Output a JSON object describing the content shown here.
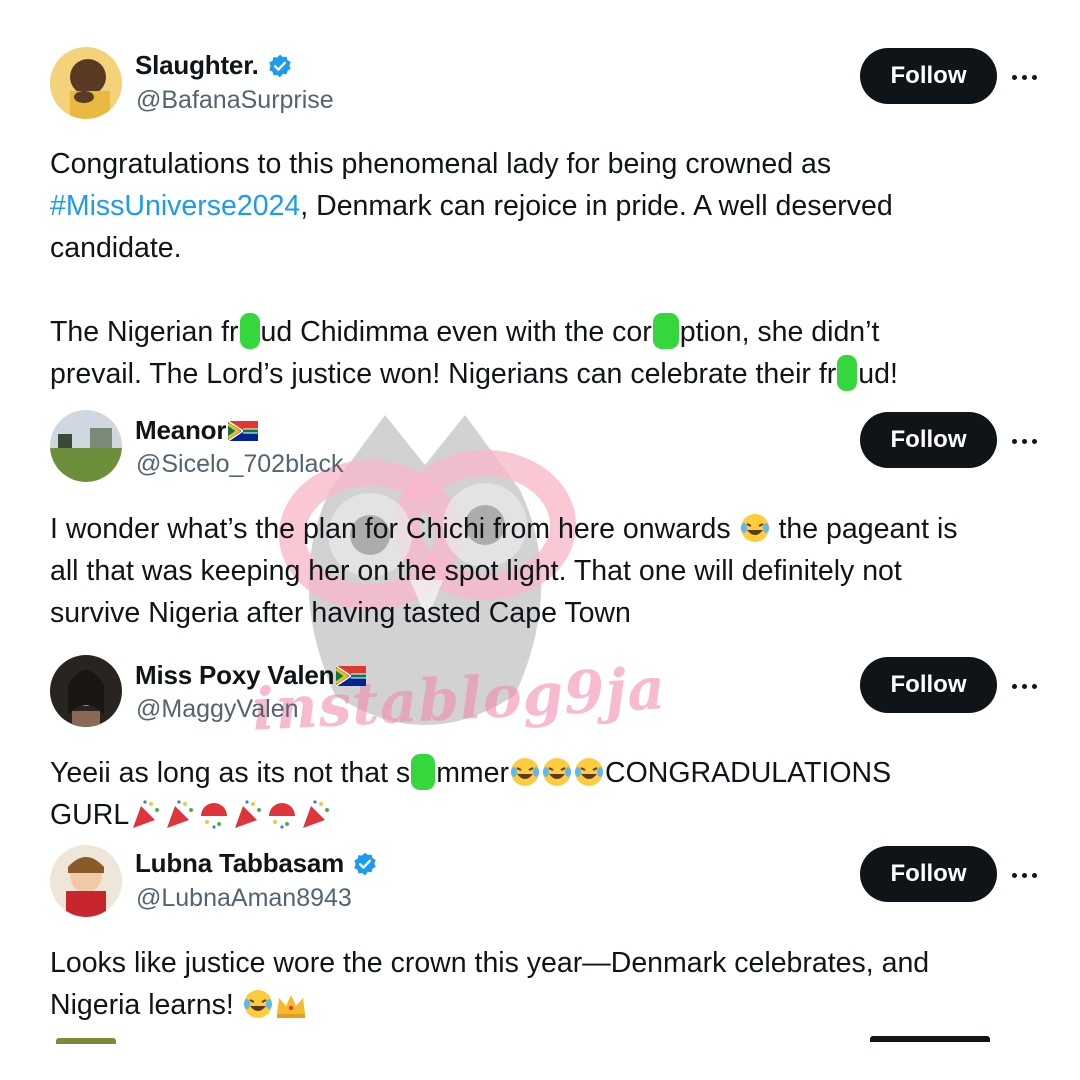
{
  "follow_label": "Follow",
  "tweets": [
    {
      "name": "Slaughter.",
      "handle": "@BafanaSurprise",
      "verified": true,
      "line1": "Congratulations to this phenomenal lady for being crowned as",
      "hashtag": "#MissUniverse2024",
      "line2_rest": ", Denmark can rejoice in pride. A well deserved",
      "line3": "candidate.",
      "line4_a": "The Nigerian fr",
      "line4_b": "ud Chidimma even with the cor",
      "line4_c": "ption, she didn’t",
      "line5_a": "prevail. The Lord’s justice won! Nigerians can celebrate their fr",
      "line5_b": "ud!"
    },
    {
      "name": "Meanor",
      "handle": "@Sicelo_702black",
      "flag": "south-africa-flag",
      "line1_a": "I wonder what’s the plan for Chichi from here onwards",
      "line1_b": "the pageant is",
      "line2": "all that was keeping her on the spot light. That one will definitely not",
      "line3": "survive Nigeria after having tasted Cape Town"
    },
    {
      "name": "Miss Poxy Valen",
      "handle": "@MaggyValen",
      "flag": "south-africa-flag",
      "line1_a": "Yeeii as long as its not that s",
      "line1_b": "mmer",
      "line1_c": "CONGRADULATIONS",
      "line2": "GURL"
    },
    {
      "name": "Lubna Tabbasam",
      "handle": "@LubnaAman8943",
      "verified": true,
      "line1": "Looks like justice wore the crown this year—Denmark celebrates, and",
      "line2": "Nigeria learns!"
    }
  ],
  "watermark": "instablog9ja",
  "colors": {
    "hashtag": "#1d9bf0",
    "handle": "#536471",
    "verified": "#1d9bf0",
    "follow_bg": "#0f1419"
  }
}
